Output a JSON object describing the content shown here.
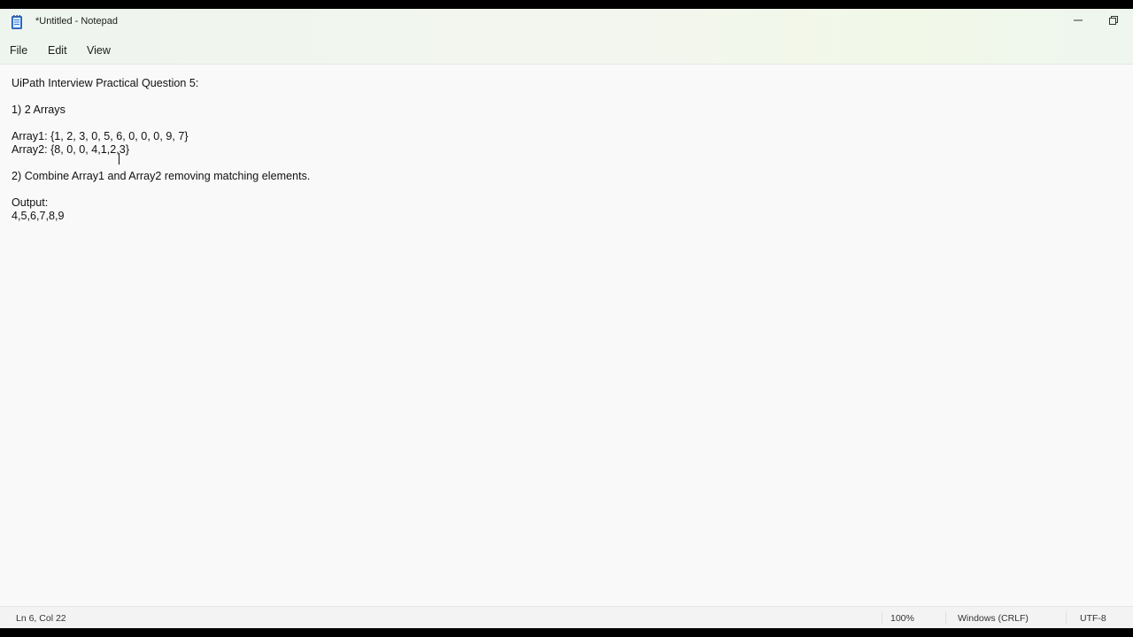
{
  "window": {
    "title": "*Untitled - Notepad",
    "app_icon": "notepad-icon"
  },
  "controls": {
    "minimize_icon": "minimize-icon",
    "restore_icon": "restore-icon"
  },
  "menu": {
    "file": "File",
    "edit": "Edit",
    "view": "View"
  },
  "document": {
    "lines": [
      "UiPath Interview Practical Question 5:",
      "",
      "1) 2 Arrays",
      "",
      "Array1: {1, 2, 3, 0, 5, 6, 0, 0, 0, 9, 7}",
      "Array2: {8, 0, 0, 4,1,2,3}",
      "",
      "2) Combine Array1 and Array2 removing matching elements.",
      "",
      "Output:",
      "4,5,6,7,8,9"
    ]
  },
  "status": {
    "position": "Ln 6, Col 22",
    "zoom": "100%",
    "line_ending": "Windows (CRLF)",
    "encoding": "UTF-8"
  },
  "colors": {
    "text": "#111111",
    "background": "#f9f9f9",
    "titlebar_tint": "#eef5ee"
  }
}
